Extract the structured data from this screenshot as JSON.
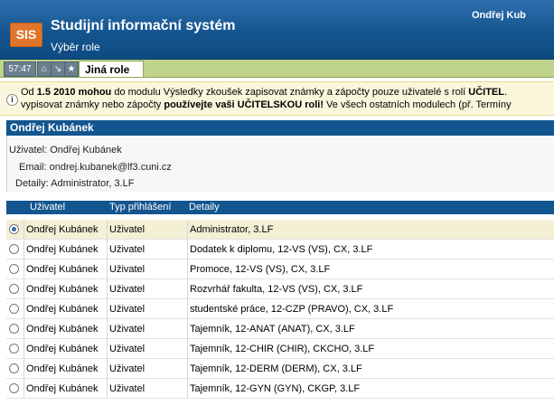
{
  "header": {
    "logo": "SIS",
    "title": "Studijní informační systém",
    "subtitle": "Výběr role",
    "user_name": "Ondřej Kub"
  },
  "toolbar": {
    "timer": "57:47",
    "buttons": [
      {
        "icon": "home-icon",
        "glyph": "⌂"
      },
      {
        "icon": "minimize-icon",
        "glyph": "↘"
      },
      {
        "icon": "star-icon",
        "glyph": "★"
      }
    ],
    "active_tab": "Jiná role"
  },
  "notice": {
    "line1_a": "Od ",
    "line1_b": "1.5 2010 mohou",
    "line1_c": " do modulu Výsledky zkoušek zapisovat známky a zápočty pouze uživatelé s rolí ",
    "line1_d": "UČITEL",
    "line1_e": ".",
    "line2_a": "vypisovat známky nebo zápočty ",
    "line2_b": "používejte vaši UČITELSKOU roli!",
    "line2_c": " Ve všech ostatních modulech (př. Termíny"
  },
  "user_box": {
    "title": "Ondřej Kubánek",
    "user_label": "Uživatel:",
    "user_value": "Ondřej Kubánek",
    "email_label": "Email:",
    "email_value": "ondrej.kubanek@lf3.cuni.cz",
    "details_label": "Detaily:",
    "details_value": "Administrator, 3.LF"
  },
  "table": {
    "columns": [
      "Uživatel",
      "Typ přihlášení",
      "Detaily"
    ],
    "rows": [
      {
        "user": "Ondřej Kubánek",
        "type": "Uživatel",
        "details": "Administrator, 3.LF",
        "selected": true
      },
      {
        "user": "Ondřej Kubánek",
        "type": "Uživatel",
        "details": "Dodatek k diplomu, 12-VS (VS), CX, 3.LF",
        "selected": false
      },
      {
        "user": "Ondřej Kubánek",
        "type": "Uživatel",
        "details": "Promoce, 12-VS (VS), CX, 3.LF",
        "selected": false
      },
      {
        "user": "Ondřej Kubánek",
        "type": "Uživatel",
        "details": "Rozvrhář fakulta, 12-VS (VS), CX, 3.LF",
        "selected": false
      },
      {
        "user": "Ondřej Kubánek",
        "type": "Uživatel",
        "details": "studentské práce, 12-CZP (PRAVO), CX, 3.LF",
        "selected": false
      },
      {
        "user": "Ondřej Kubánek",
        "type": "Uživatel",
        "details": "Tajemník, 12-ANAT (ANAT), CX, 3.LF",
        "selected": false
      },
      {
        "user": "Ondřej Kubánek",
        "type": "Uživatel",
        "details": "Tajemník, 12-CHIR (CHIR), CKCHO, 3.LF",
        "selected": false
      },
      {
        "user": "Ondřej Kubánek",
        "type": "Uživatel",
        "details": "Tajemník, 12-DERM (DERM), CX, 3.LF",
        "selected": false
      },
      {
        "user": "Ondřej Kubánek",
        "type": "Uživatel",
        "details": "Tajemník, 12-GYN (GYN), CKGP, 3.LF",
        "selected": false
      }
    ]
  }
}
